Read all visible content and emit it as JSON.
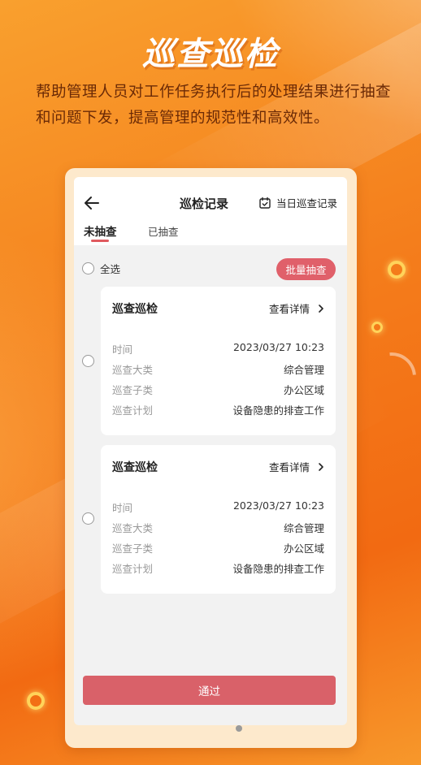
{
  "hero": {
    "title": "巡查巡检",
    "description": "帮助管理人员对工作任务执行后的处理结果进行抽查和问题下发，提高管理的规范性和高效性。"
  },
  "screen": {
    "nav_title": "巡检记录",
    "daily_record_label": "当日巡查记录",
    "tabs": [
      {
        "label": "未抽查",
        "active": true
      },
      {
        "label": "已抽查",
        "active": false
      }
    ],
    "select_all_label": "全选",
    "batch_check_label": "批量抽查",
    "records": [
      {
        "title": "巡查巡检",
        "detail_label": "查看详情",
        "fields": [
          {
            "key": "时间",
            "value": "2023/03/27 10:23"
          },
          {
            "key": "巡查大类",
            "value": "综合管理"
          },
          {
            "key": "巡查子类",
            "value": "办公区域"
          },
          {
            "key": "巡查计划",
            "value": "设备隐患的排查工作"
          }
        ]
      },
      {
        "title": "巡查巡检",
        "detail_label": "查看详情",
        "fields": [
          {
            "key": "时间",
            "value": "2023/03/27 10:23"
          },
          {
            "key": "巡查大类",
            "value": "综合管理"
          },
          {
            "key": "巡查子类",
            "value": "办公区域"
          },
          {
            "key": "巡查计划",
            "value": "设备隐患的排查工作"
          }
        ]
      }
    ],
    "pass_label": "通过"
  },
  "icons": {
    "back": "arrow-left-icon",
    "calendar": "calendar-check-icon",
    "chevron": "chevron-right-icon"
  },
  "colors": {
    "background": "#f58a1f",
    "accent": "#e0606a",
    "hero_text": "#6b2a06"
  }
}
